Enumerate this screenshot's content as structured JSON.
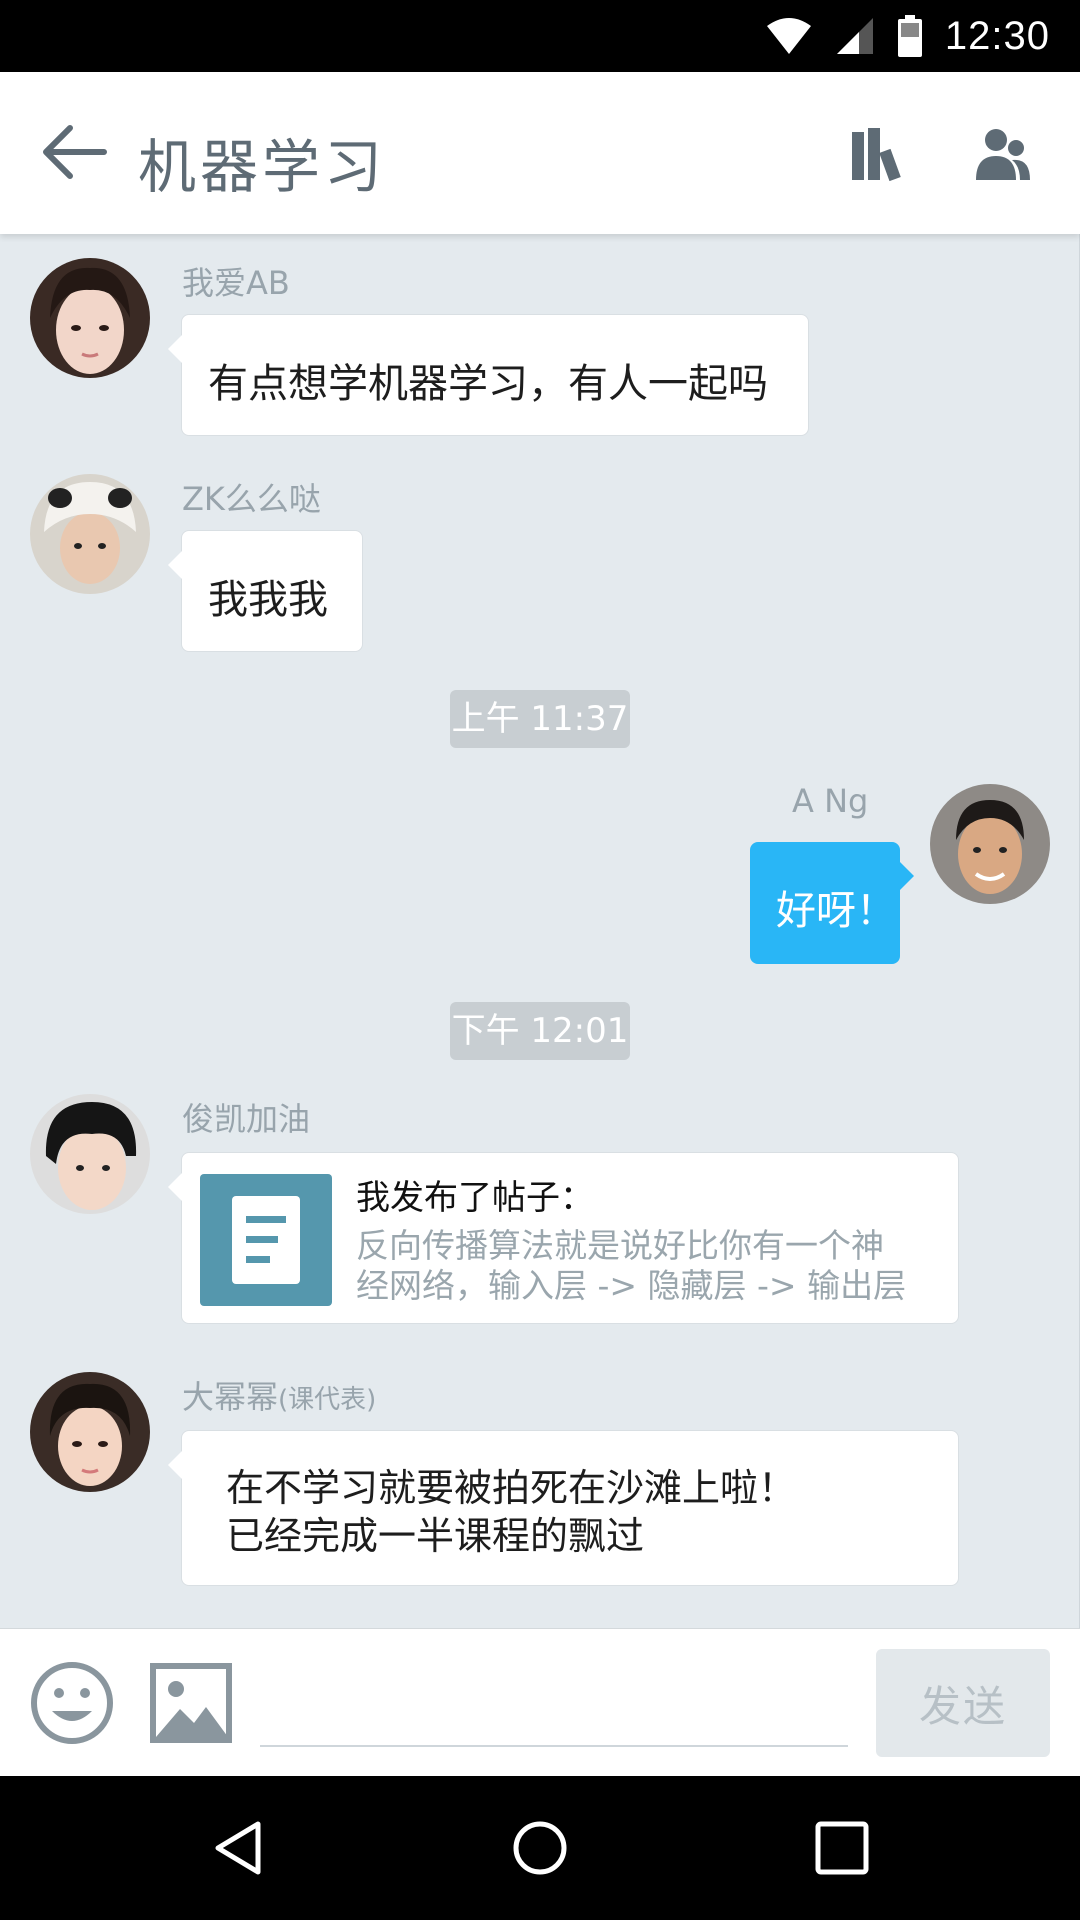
{
  "status_bar": {
    "time": "12:30",
    "icons": [
      "wifi-icon",
      "signal-icon",
      "battery-icon"
    ]
  },
  "header": {
    "title": "机器学习",
    "icons": [
      "back-arrow-icon",
      "library-icon",
      "members-icon"
    ]
  },
  "messages": [
    {
      "sender": "我爱AB",
      "text": "有点想学机器学习，有人一起吗",
      "side": "left"
    },
    {
      "sender": "ZK么么哒",
      "text": "我我我",
      "side": "left"
    },
    {
      "timestamp": "上午 11:37"
    },
    {
      "sender": "A Ng",
      "text": "好呀！",
      "side": "right"
    },
    {
      "timestamp": "下午 12:01"
    },
    {
      "sender": "俊凯加油",
      "post_title": "我发布了帖子：",
      "post_preview_line1": "反向传播算法就是说好比你有一个神",
      "post_preview_line2": "经网络，输入层 -> 隐藏层 -> 输出层",
      "side": "left"
    },
    {
      "sender": "大幂幂",
      "sender_tag": "(课代表)",
      "text_line1": "在不学习就要被拍死在沙滩上啦！",
      "text_line2": "已经完成一半课程的飘过",
      "side": "left"
    }
  ],
  "input_bar": {
    "placeholder": "",
    "send_label": "发送",
    "icons": [
      "emoji-icon",
      "image-icon"
    ]
  },
  "nav_bar": {
    "icons": [
      "nav-back-icon",
      "nav-home-icon",
      "nav-recents-icon"
    ]
  },
  "colors": {
    "accent": "#29b6f6",
    "chat_bg": "#e4eaee",
    "post_icon": "#5597ad"
  }
}
